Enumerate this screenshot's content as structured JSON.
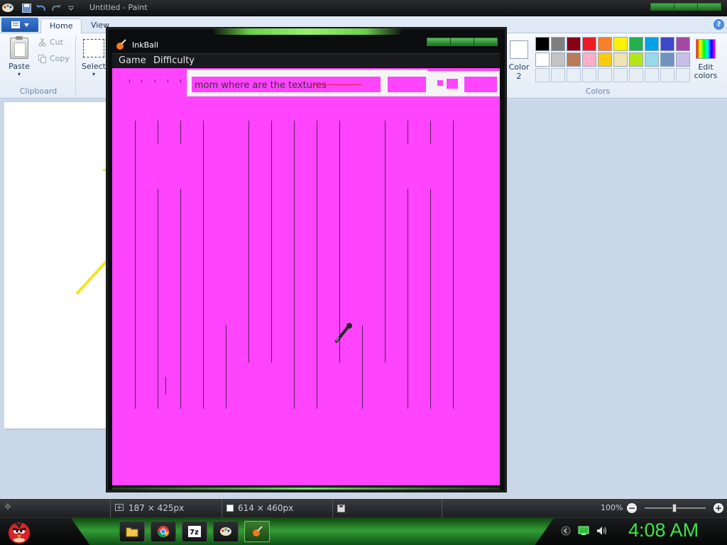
{
  "paint": {
    "title": "Untitled - Paint",
    "tabs": [
      "Home",
      "View"
    ],
    "clipboard": {
      "paste": "Paste",
      "cut": "Cut",
      "copy": "Copy",
      "group": "Clipboard"
    },
    "select": "Select",
    "color2": {
      "line1": "Color",
      "line2": "2"
    },
    "edit_colors": {
      "line1": "Edit",
      "line2": "colors"
    },
    "colors_group": "Colors",
    "palette_row1": [
      "#000000",
      "#7f7f7f",
      "#880015",
      "#ed1c24",
      "#ff7f27",
      "#fff200",
      "#22b14c",
      "#00a2e8",
      "#3f48cc",
      "#a349a4"
    ],
    "palette_row2": [
      "#ffffff",
      "#c3c3c3",
      "#b97a57",
      "#ffaec9",
      "#ffc90e",
      "#efe4b0",
      "#b5e61d",
      "#99d9ea",
      "#7092be",
      "#c8bfe7"
    ],
    "status": {
      "cursor_pos": "187 × 425px",
      "canvas_size": "614 × 460px",
      "zoom": "100%"
    }
  },
  "inkball": {
    "title": "InkBall",
    "menu": [
      "Game",
      "Difficulty"
    ],
    "hud_text": "mom where are the textures",
    "field_color": "#ff44ff"
  },
  "taskbar": {
    "clock": "4:08 AM"
  },
  "colors": {
    "accent_green": "#3fe34a"
  }
}
